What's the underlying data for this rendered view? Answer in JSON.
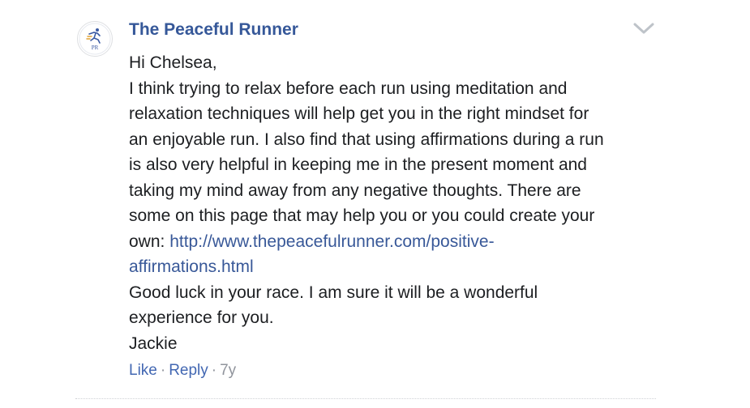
{
  "comment": {
    "author": "The Peaceful Runner",
    "avatar_text": "PR",
    "icon": "chevron-down-icon",
    "body": {
      "greeting": "Hi Chelsea,",
      "lines_before_link": [
        "I think trying to relax before each run using meditation and",
        "relaxation techniques will help get you in the right mindset for",
        "an enjoyable run. I also find that using affirmations during a run",
        "is also very helpful in keeping me in the present moment and",
        "taking my mind away from any negative thoughts. There are",
        "some on this page that may help you or you could create your"
      ],
      "link_prefix": "own: ",
      "link_line1": "http://www.thepeacefulrunner.com/positive-",
      "link_line2": "affirmations.html",
      "closing_lines": [
        "Good luck in your race. I am sure it will be a wonderful",
        "experience for you."
      ],
      "signature": "Jackie"
    },
    "actions": {
      "like": "Like",
      "separator": "·",
      "reply": "Reply",
      "time": "7y"
    },
    "colors": {
      "author": "#365899",
      "link": "#385898",
      "text": "#1c1e21",
      "meta": "#90949c"
    }
  }
}
